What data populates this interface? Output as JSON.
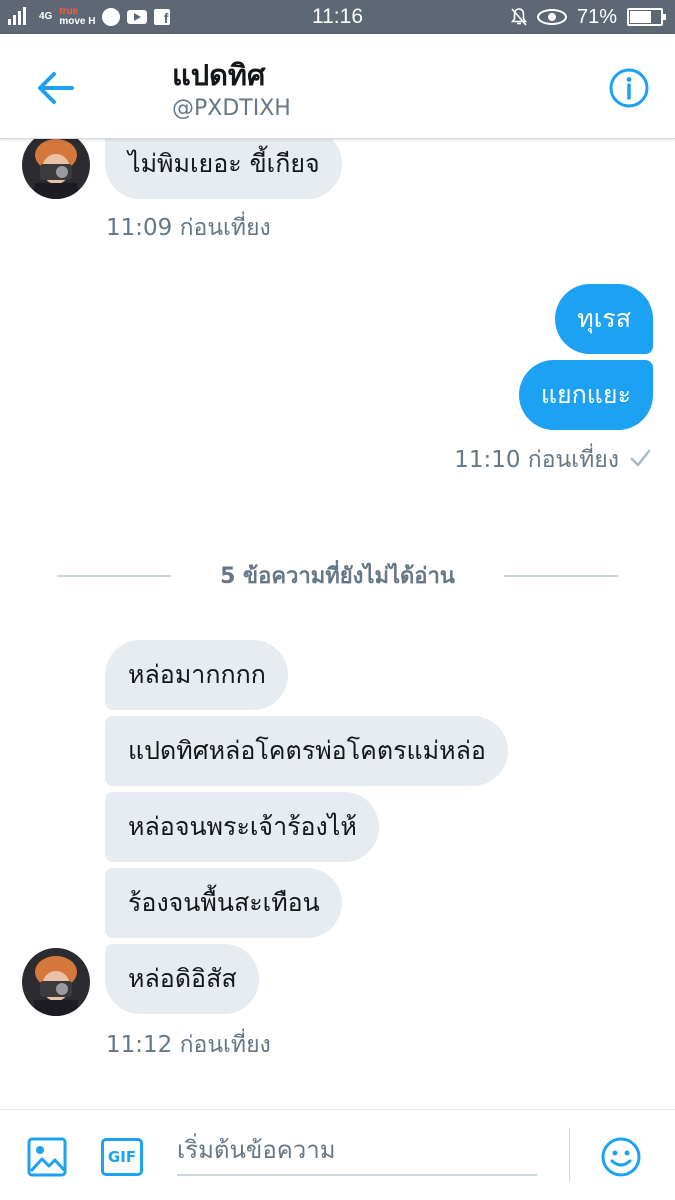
{
  "status_bar": {
    "network": "4G",
    "carrier_line1": "true",
    "carrier_line2": "move H",
    "time": "11:16",
    "battery": "71%",
    "battery_level": 0.71,
    "icons": [
      "signal-icon",
      "globe-icon",
      "youtube-icon",
      "facebook-icon",
      "mute-bell-icon",
      "eye-icon",
      "battery-icon"
    ]
  },
  "header": {
    "title": "แปดทิศ",
    "handle": "@PXDTIXH"
  },
  "messages": {
    "top_incoming": "ไม่พิมเยอะ ขี้เกียจ",
    "top_time": "11:09 ก่อนเที่ยง",
    "sent_1": "ทุเรส",
    "sent_2": "แยกแยะ",
    "sent_time": "11:10 ก่อนเที่ยง",
    "unread_divider": "5 ข้อความที่ยังไม่ได้อ่าน",
    "incoming": [
      "หล่อมากกกก",
      "แปดทิศหล่อโคตรพ่อโคตรแม่หล่อ",
      "หล่อจนพระเจ้าร้องไห้",
      "ร้องจนพื้นสะเทือน",
      "หล่อดิอิสัส"
    ],
    "incoming_time": "11:12 ก่อนเที่ยง"
  },
  "composer": {
    "gif_label": "GIF",
    "placeholder": "เริ่มต้นข้อความ"
  },
  "colors": {
    "accent": "#1da1f2",
    "incoming_bubble": "#e6ecf0",
    "secondary_text": "#657786",
    "status_bar": "#5e6874"
  }
}
